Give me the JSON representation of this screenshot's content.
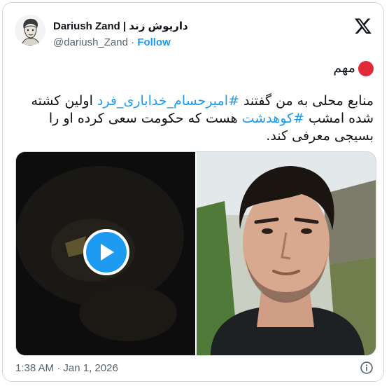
{
  "author": {
    "display_name": "Dariush Zand | داریوش زند",
    "handle": "@dariush_Zand",
    "separator": "·",
    "follow_label": "Follow"
  },
  "badge": {
    "text": "مهم",
    "dot_color": "#e02a3a"
  },
  "tweet": {
    "text_before": "منابع محلی به من گفتند ",
    "hashtag_1": "#امیرحسام_خداباری_فرد",
    "text_middle": " اولین کشته شده امشب ",
    "hashtag_2": "#کوهدشت",
    "text_after": " هست که حکومت سعی کرده او را بسیجی معرفی کند."
  },
  "meta": {
    "time": "1:38 AM",
    "separator": "·",
    "date": "Jan 1, 2026"
  },
  "icons": {
    "logo": "x-logo-icon",
    "play": "play-icon",
    "info": "info-icon"
  },
  "colors": {
    "link": "#1d9bf0",
    "text": "#0f1419",
    "muted": "#536471"
  }
}
